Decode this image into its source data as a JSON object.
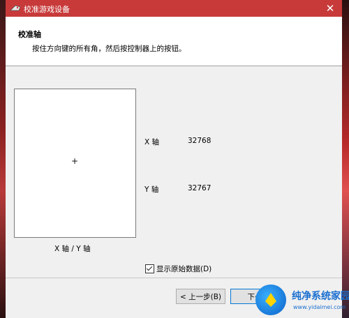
{
  "window": {
    "title": "校准游戏设备",
    "close_symbol": "✕"
  },
  "header": {
    "title": "校准轴",
    "subtitle": "按住方向键的所有角，然后按控制器上的按钮。"
  },
  "calibration": {
    "crosshair_symbol": "+",
    "box_label": "X 轴 / Y 轴"
  },
  "axes": [
    {
      "name": "X 轴",
      "value": "32768"
    },
    {
      "name": "Y 轴",
      "value": "32767"
    }
  ],
  "raw_data": {
    "label": "显示原始数据(D)",
    "checked": true
  },
  "buttons": {
    "prev": "< 上一步(B)",
    "next": "下一"
  },
  "watermark": {
    "text": "纯净系统家园",
    "url": "www.yidaimei.com"
  },
  "icons": [
    "joystick-icon",
    "close-icon",
    "crosshair-icon",
    "checkbox-check-icon",
    "watermark-logo-icon"
  ],
  "colors": {
    "titlebar": "#c83a3a",
    "window_bg": "#f0f0f0",
    "header_bg": "#ffffff",
    "focus_border": "#0078d7"
  }
}
